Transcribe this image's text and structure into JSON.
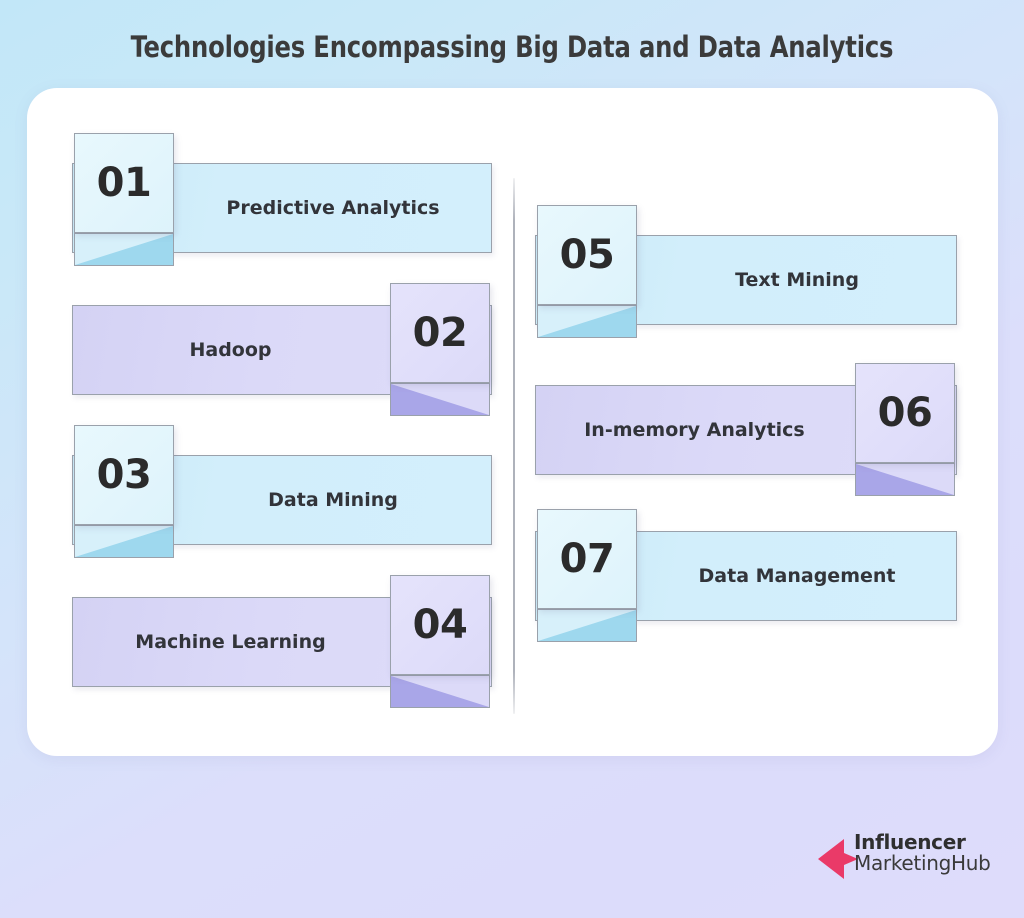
{
  "title": "Technologies Encompassing Big Data and Data Analytics",
  "colors": {
    "bg_start": "#c2e7f8",
    "bg_end": "#dcdcfb",
    "card_bg": "#ffffff",
    "bar_cyan": "#d2eefb",
    "bar_purple": "#dbd9f8",
    "badge_cyan": "#e2f5fc",
    "badge_purple": "#e0defa",
    "fold_cyan": "#9ed8ee",
    "fold_purple": "#a9a6e8",
    "text": "#32343a",
    "logo_accent": "#ea3a68"
  },
  "columns": [
    {
      "name": "left-column",
      "items": [
        {
          "number": "01",
          "label": "Predictive Analytics",
          "theme": "cyan",
          "badge_side": "left"
        },
        {
          "number": "02",
          "label": "Hadoop",
          "theme": "purple",
          "badge_side": "right"
        },
        {
          "number": "03",
          "label": "Data Mining",
          "theme": "cyan",
          "badge_side": "left"
        },
        {
          "number": "04",
          "label": "Machine Learning",
          "theme": "purple",
          "badge_side": "right"
        }
      ]
    },
    {
      "name": "right-column",
      "items": [
        {
          "number": "05",
          "label": "Text Mining",
          "theme": "cyan",
          "badge_side": "left"
        },
        {
          "number": "06",
          "label": "In-memory Analytics",
          "theme": "purple",
          "badge_side": "right"
        },
        {
          "number": "07",
          "label": "Data Management",
          "theme": "cyan",
          "badge_side": "left"
        }
      ]
    }
  ],
  "logo": {
    "line1": "Influencer",
    "line2_a": "Marketing",
    "line2_b": "Hub",
    "arrow_icon": "left-arrow-icon"
  }
}
